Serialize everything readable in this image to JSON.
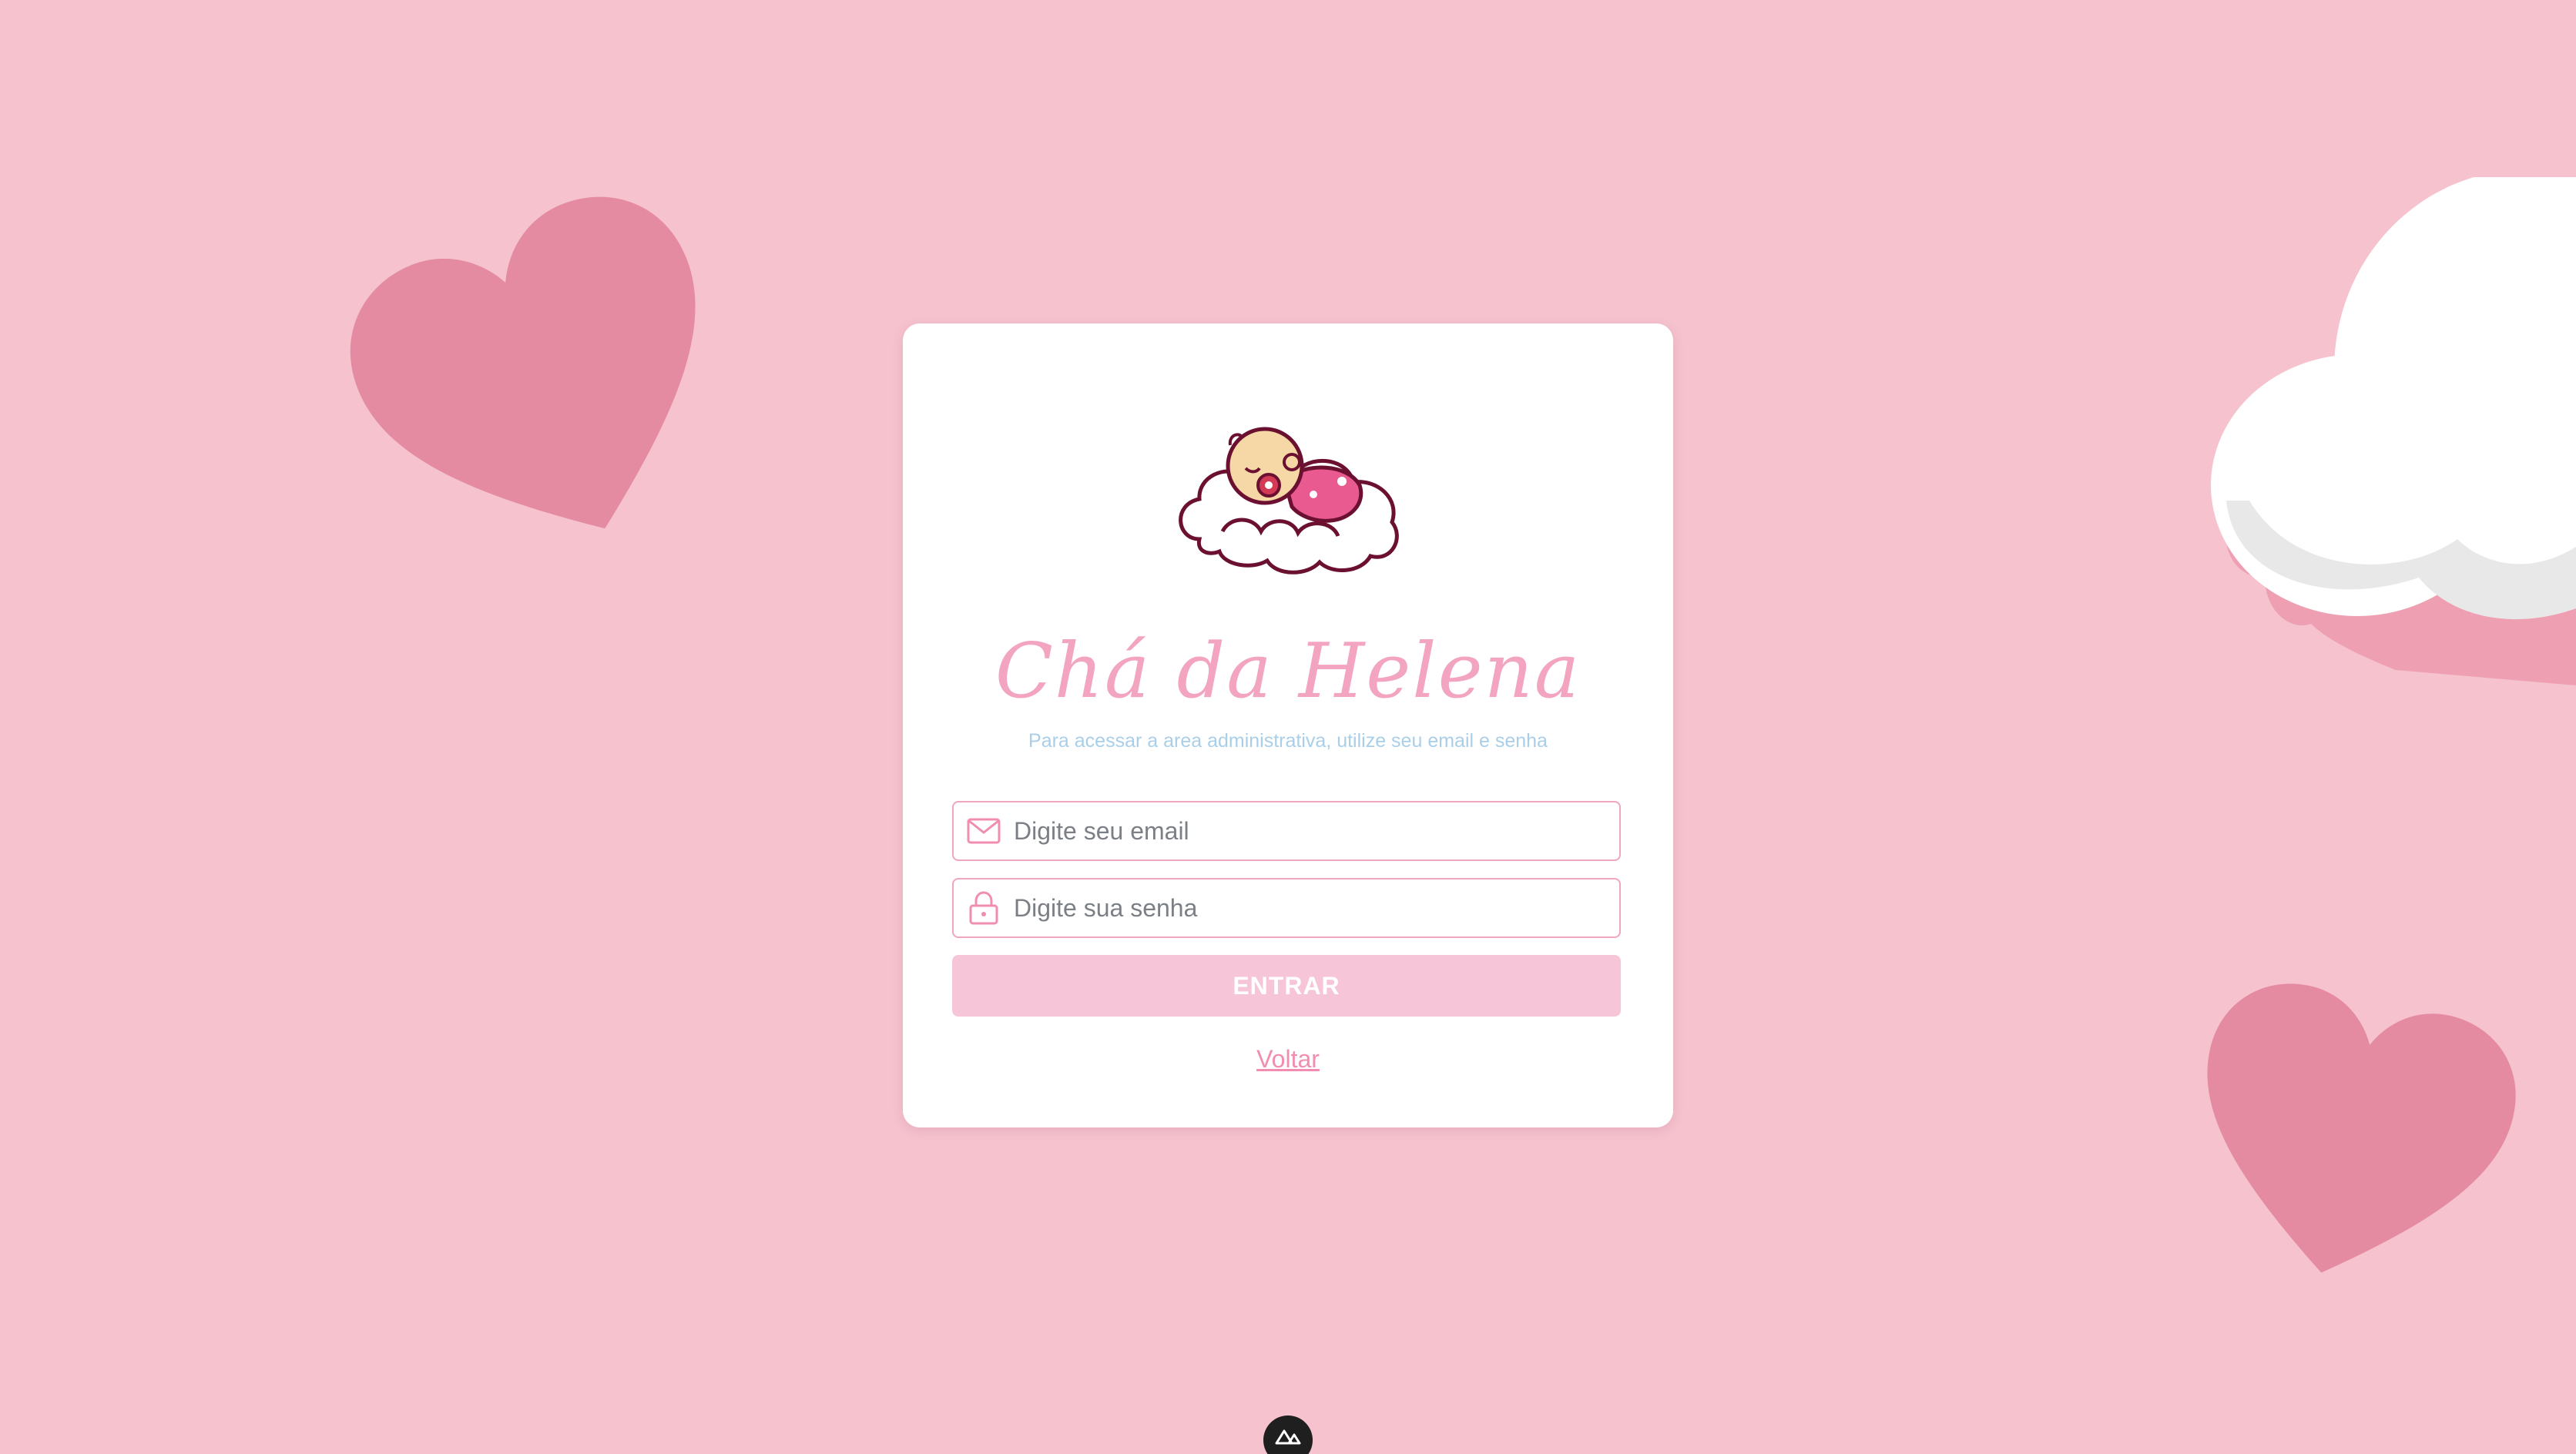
{
  "brand": {
    "title": "Chá da Helena",
    "subtitle": "Para acessar a area administrativa, utilize seu email e senha"
  },
  "form": {
    "email": {
      "placeholder": "Digite seu email",
      "value": "",
      "icon": "envelope-icon"
    },
    "password": {
      "placeholder": "Digite sua senha",
      "value": "",
      "icon": "lock-icon"
    },
    "submit_label": "ENTRAR",
    "back_label": "Voltar"
  },
  "colors": {
    "background": "#f5c2ce",
    "accent_pink": "#f0a6bf",
    "button_pink": "#f6c6d8",
    "heart": "#e48ba2",
    "subtitle_blue": "#a9cfe8"
  }
}
